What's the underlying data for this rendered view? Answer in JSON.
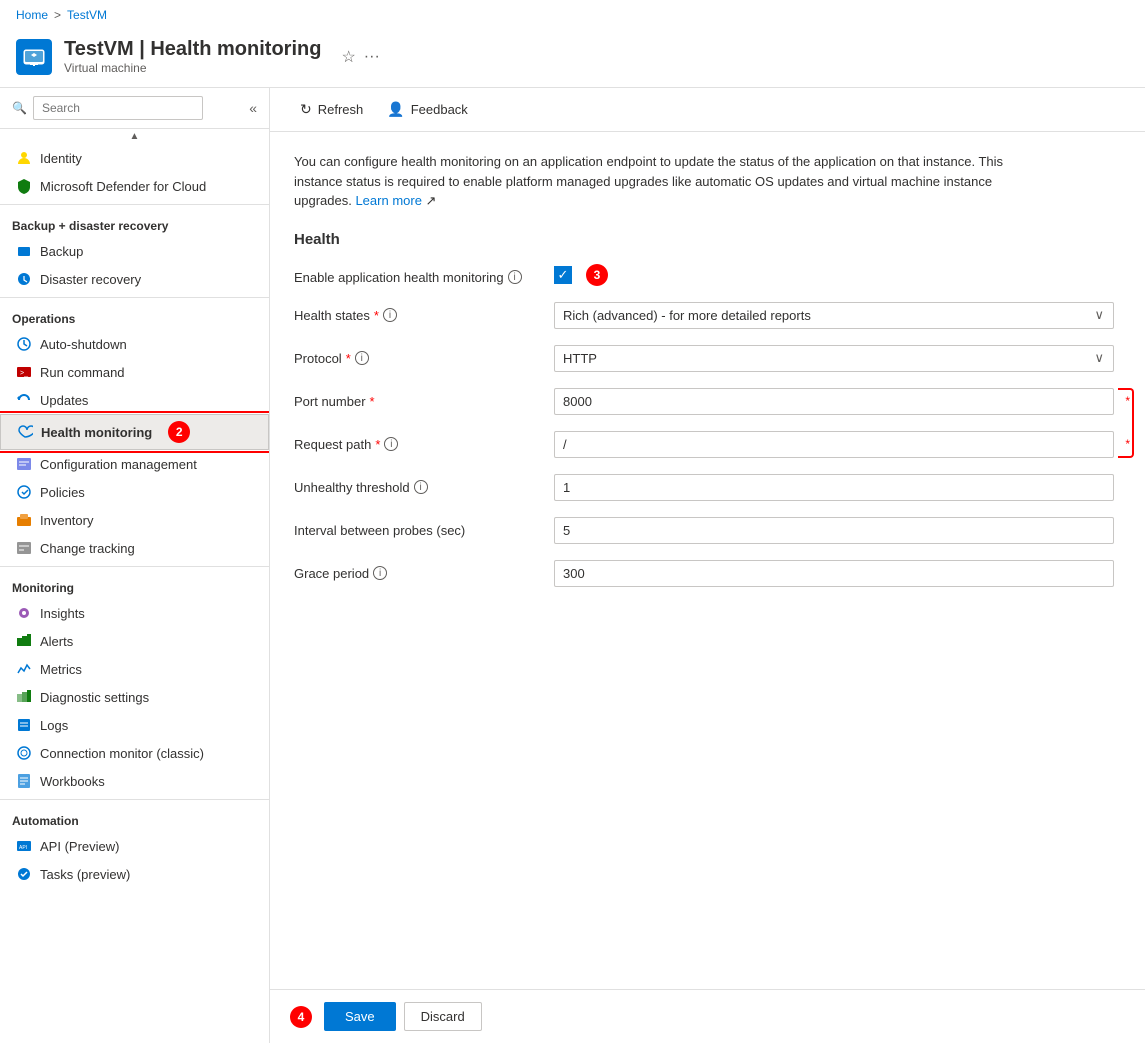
{
  "breadcrumb": {
    "home": "Home",
    "vm": "TestVM",
    "separator": ">"
  },
  "header": {
    "title": "TestVM | Health monitoring",
    "subtitle": "Virtual machine",
    "star_icon": "☆",
    "more_icon": "···"
  },
  "toolbar": {
    "refresh_label": "Refresh",
    "feedback_label": "Feedback"
  },
  "sidebar": {
    "search_placeholder": "Search",
    "sections": [
      {
        "label": "",
        "items": [
          {
            "id": "identity",
            "label": "Identity",
            "icon_color": "#ffd700"
          },
          {
            "id": "defender",
            "label": "Microsoft Defender for Cloud",
            "icon_color": "#107c10"
          }
        ]
      },
      {
        "label": "Backup + disaster recovery",
        "items": [
          {
            "id": "backup",
            "label": "Backup",
            "icon_color": "#0078d4"
          },
          {
            "id": "disaster-recovery",
            "label": "Disaster recovery",
            "icon_color": "#0078d4"
          }
        ]
      },
      {
        "label": "Operations",
        "items": [
          {
            "id": "auto-shutdown",
            "label": "Auto-shutdown",
            "icon_color": "#0078d4"
          },
          {
            "id": "run-command",
            "label": "Run command",
            "icon_color": "#c00000"
          },
          {
            "id": "updates",
            "label": "Updates",
            "icon_color": "#0078d4"
          },
          {
            "id": "health-monitoring",
            "label": "Health monitoring",
            "icon_color": "#0078d4",
            "active": true
          },
          {
            "id": "configuration-management",
            "label": "Configuration management",
            "icon_color": "#0078d4"
          },
          {
            "id": "policies",
            "label": "Policies",
            "icon_color": "#0078d4"
          },
          {
            "id": "inventory",
            "label": "Inventory",
            "icon_color": "#e67e00"
          },
          {
            "id": "change-tracking",
            "label": "Change tracking",
            "icon_color": "#0078d4"
          }
        ]
      },
      {
        "label": "Monitoring",
        "items": [
          {
            "id": "insights",
            "label": "Insights",
            "icon_color": "#9b59b6"
          },
          {
            "id": "alerts",
            "label": "Alerts",
            "icon_color": "#107c10"
          },
          {
            "id": "metrics",
            "label": "Metrics",
            "icon_color": "#0078d4"
          },
          {
            "id": "diagnostic-settings",
            "label": "Diagnostic settings",
            "icon_color": "#107c10"
          },
          {
            "id": "logs",
            "label": "Logs",
            "icon_color": "#0078d4"
          },
          {
            "id": "connection-monitor",
            "label": "Connection monitor (classic)",
            "icon_color": "#0078d4"
          },
          {
            "id": "workbooks",
            "label": "Workbooks",
            "icon_color": "#0078d4"
          }
        ]
      },
      {
        "label": "Automation",
        "items": [
          {
            "id": "api-preview",
            "label": "API (Preview)",
            "icon_color": "#0078d4"
          },
          {
            "id": "tasks-preview",
            "label": "Tasks (preview)",
            "icon_color": "#0078d4"
          }
        ]
      }
    ]
  },
  "content": {
    "description": "You can configure health monitoring on an application endpoint to update the status of the application on that instance. This instance status is required to enable platform managed upgrades like automatic OS updates and virtual machine instance upgrades.",
    "learn_more": "Learn more",
    "section_title": "Health",
    "fields": {
      "enable_label": "Enable application health monitoring",
      "health_states_label": "Health states",
      "health_states_value": "Rich (advanced) - for more detailed reports",
      "protocol_label": "Protocol",
      "protocol_value": "HTTP",
      "port_number_label": "Port number",
      "port_number_value": "8000",
      "request_path_label": "Request path",
      "request_path_value": "/",
      "unhealthy_threshold_label": "Unhealthy threshold",
      "unhealthy_threshold_value": "1",
      "interval_label": "Interval between probes (sec)",
      "interval_value": "5",
      "grace_period_label": "Grace period",
      "grace_period_value": "300"
    },
    "annotations": {
      "step2": "2",
      "step3": "3",
      "step4": "4"
    }
  },
  "footer": {
    "save_label": "Save",
    "discard_label": "Discard"
  },
  "icons": {
    "vm_icon": "💻",
    "refresh_icon": "↻",
    "feedback_icon": "👤",
    "search_icon": "🔍",
    "info_icon": "i",
    "chevron_down": "∨",
    "chevron_left": "«"
  }
}
